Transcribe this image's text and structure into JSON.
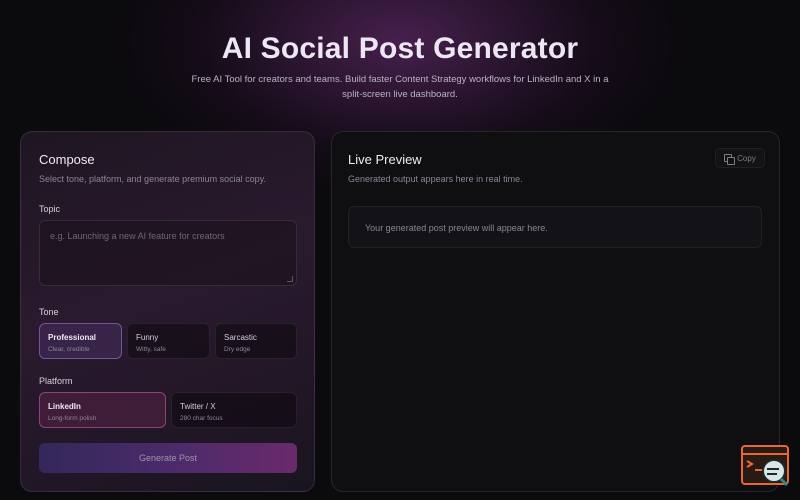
{
  "header": {
    "title": "AI Social Post Generator",
    "subtitle": "Free AI Tool for creators and teams. Build faster Content Strategy workflows for LinkedIn and X in a split-screen live dashboard."
  },
  "compose": {
    "title": "Compose",
    "description": "Select tone, platform, and generate premium social copy.",
    "topic_label": "Topic",
    "topic_placeholder": "e.g. Launching a new AI feature for creators",
    "topic_value": "",
    "tone_label": "Tone",
    "tones": [
      {
        "title": "Professional",
        "sub": "Clear, credible",
        "selected": true
      },
      {
        "title": "Funny",
        "sub": "Witty, safe",
        "selected": false
      },
      {
        "title": "Sarcastic",
        "sub": "Dry edge",
        "selected": false
      }
    ],
    "platform_label": "Platform",
    "platforms": [
      {
        "title": "LinkedIn",
        "sub": "Long-form polish",
        "selected": true
      },
      {
        "title": "Twitter / X",
        "sub": "280 char focus",
        "selected": false
      }
    ],
    "generate_label": "Generate Post"
  },
  "preview": {
    "title": "Live Preview",
    "description": "Generated output appears here in real time.",
    "copy_label": "Copy",
    "placeholder_text": "Your generated post preview will appear here."
  },
  "icons": {
    "copy": "copy-icon",
    "widget": "assistant-widget-icon"
  },
  "colors": {
    "background": "#0b0a0d",
    "accent_purple": "#4a2b6a",
    "accent_pink": "#6a2a6a",
    "widget_orange": "#e8663a",
    "widget_teal": "#2a8a8a"
  }
}
